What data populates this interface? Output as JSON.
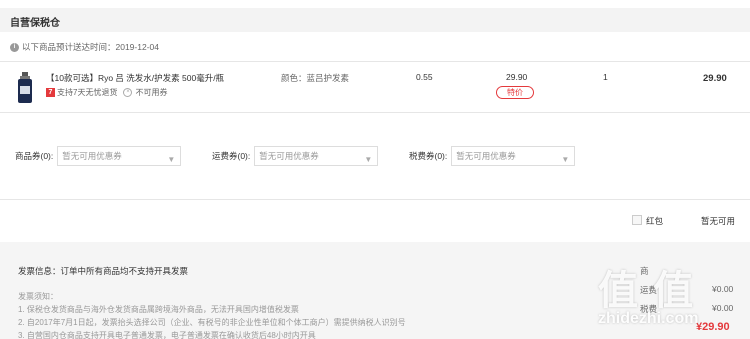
{
  "warehouse": {
    "title": "自营保税仓"
  },
  "delivery": {
    "text": "以下商品预计送达时间：2019-12-04"
  },
  "product": {
    "name": "【10款可选】Ryo 吕 洗发水/护发素 500毫升/瓶",
    "color_spec": "颜色：蓝吕护发素",
    "tax": "0.55",
    "unit_price": "29.90",
    "special_tag": "特价",
    "quantity": "1",
    "subtotal": "29.90",
    "seven_day_badge": "7",
    "return_service": "支持7天无忧退货",
    "no_coupon": "不可用券"
  },
  "coupons": {
    "product_label": "商品券(0):",
    "shipping_label": "运费券(0):",
    "tax_label": "税费券(0):",
    "placeholder": "暂无可用优惠券"
  },
  "redpack": {
    "label": "红包",
    "status": "暂无可用"
  },
  "footer": {
    "invoice_info": "发票信息：订单中所有商品均不支持开具发票",
    "notes_heading": "发票须知：",
    "notes": [
      "1. 保税仓发货商品与海外仓发货商品属跨境海外商品，无法开具国内增值税发票",
      "2. 自2017年7月1日起，发票抬头选择公司（企业、有税号的非企业性单位和个体工商户）需提供纳税人识别号",
      "3. 自营国内仓商品支持开具电子普通发票，电子普通发票在确认收货后48小时内开具"
    ]
  },
  "summary": {
    "row1_label": "商",
    "row1_value": "",
    "row2_label": "运费",
    "row2_value": "¥0.00",
    "row3_label": "税费",
    "row3_value": "¥0.00",
    "total_value": "¥29.90"
  },
  "watermark": {
    "glyphs": "值 值",
    "site": "zhidezhi.com"
  },
  "colors": {
    "accent_red": "#e4393c",
    "footer_bg": "#f5f5f5",
    "bar_bg": "#f3f3f3"
  },
  "icons": [
    "info-icon",
    "shampoo-bottle-icon",
    "seven-day-badge-icon",
    "no-coupon-icon",
    "chevron-down-icon",
    "checkbox-icon"
  ]
}
